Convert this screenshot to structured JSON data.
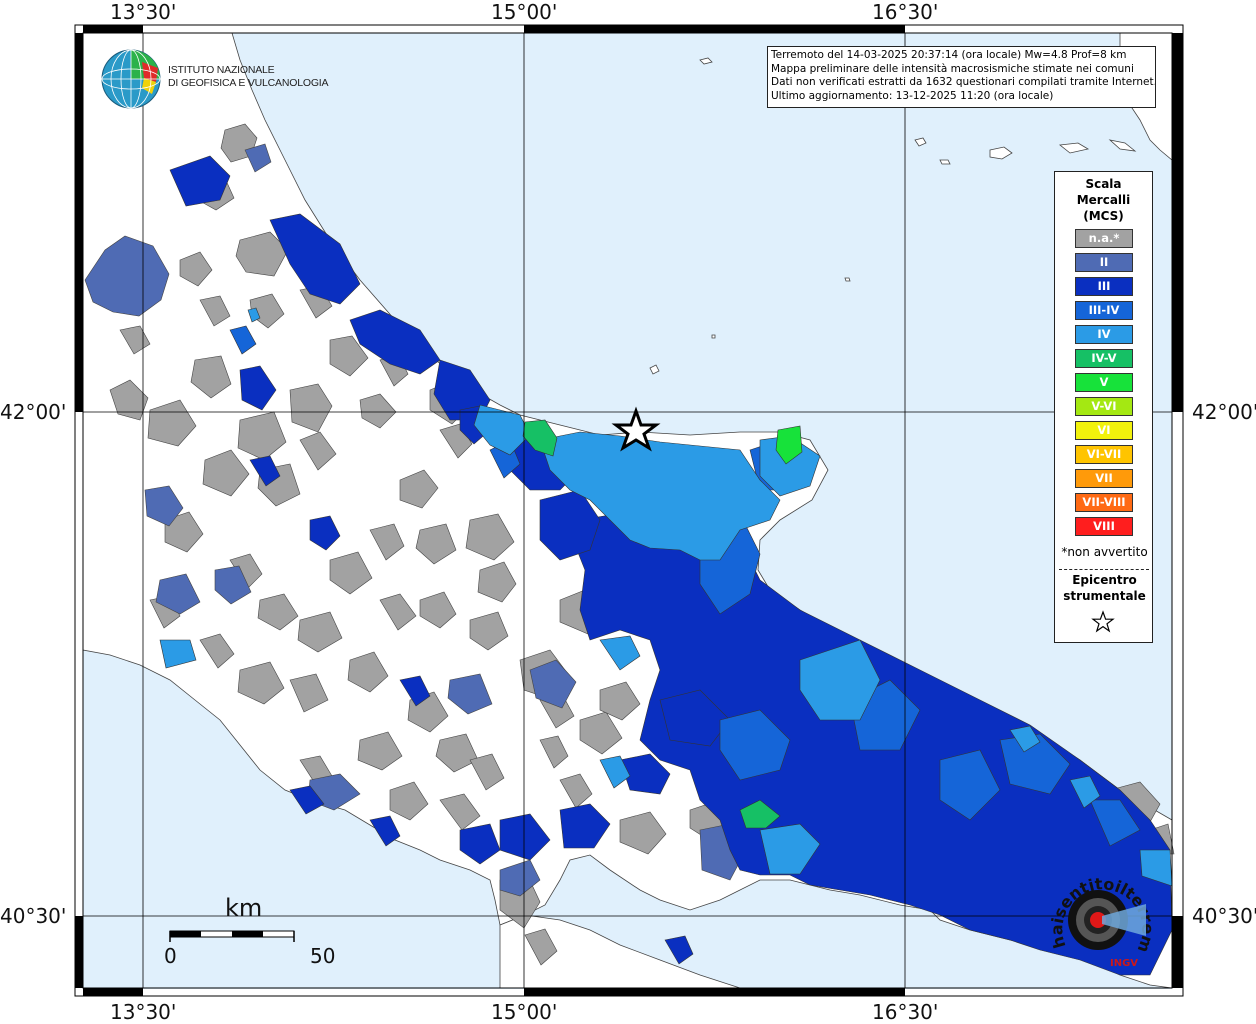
{
  "map": {
    "top_lon_labels": [
      "13°30'",
      "15°00'",
      "16°30'"
    ],
    "bottom_lon_labels": [
      "13°30'",
      "15°00'",
      "16°30'"
    ],
    "left_lat_labels": [
      "42°00'",
      "40°30'"
    ],
    "right_lat_labels": [
      "42°00'",
      "40°30'"
    ],
    "colors": {
      "sea": "#e0f0fc",
      "land": "#ffffff",
      "na": "#a2a2a2",
      "II": "#4f6bb4",
      "III": "#0a2fc0",
      "III_IV": "#1565d8",
      "IV": "#2b9be6",
      "IV_V": "#16c065",
      "V": "#17e23a"
    }
  },
  "logo": {
    "line1": "ISTITUTO NAZIONALE",
    "line2": "DI GEOFISICA E VULCANOLOGIA"
  },
  "info": {
    "line1": "Terremoto del 14-03-2025 20:37:14 (ora locale) Mw=4.8 Prof=8 km",
    "line2": "Mappa preliminare delle intensità macrosismiche stimate nei comuni",
    "line3": "Dati non verificati estratti da 1632 questionari compilati tramite Internet.",
    "line4": "Ultimo aggiornamento: 13-12-2025 11:20 (ora locale)"
  },
  "legend": {
    "title1": "Scala",
    "title2": "Mercalli",
    "title3": "(MCS)",
    "items": [
      {
        "label": "n.a.*",
        "color": "#a2a2a2"
      },
      {
        "label": "II",
        "color": "#4f6bb4"
      },
      {
        "label": "III",
        "color": "#0a2fc0"
      },
      {
        "label": "III-IV",
        "color": "#1565d8"
      },
      {
        "label": "IV",
        "color": "#2b9be6"
      },
      {
        "label": "IV-V",
        "color": "#16c065"
      },
      {
        "label": "V",
        "color": "#17e23a"
      },
      {
        "label": "V-VI",
        "color": "#a4e812"
      },
      {
        "label": "VI",
        "color": "#f2f20c"
      },
      {
        "label": "VI-VII",
        "color": "#ffc400"
      },
      {
        "label": "VII",
        "color": "#ff9a0a"
      },
      {
        "label": "VII-VIII",
        "color": "#ff6a14"
      },
      {
        "label": "VIII",
        "color": "#ff1e1e"
      }
    ],
    "note": "*non avvertito",
    "epicenter1": "Epicentro",
    "epicenter2": "strumentale"
  },
  "scalebar": {
    "unit": "km",
    "zero": "0",
    "max": "50"
  },
  "hai_logo": {
    "text": "haisentitoilterremoto.it",
    "short": "INGV"
  }
}
